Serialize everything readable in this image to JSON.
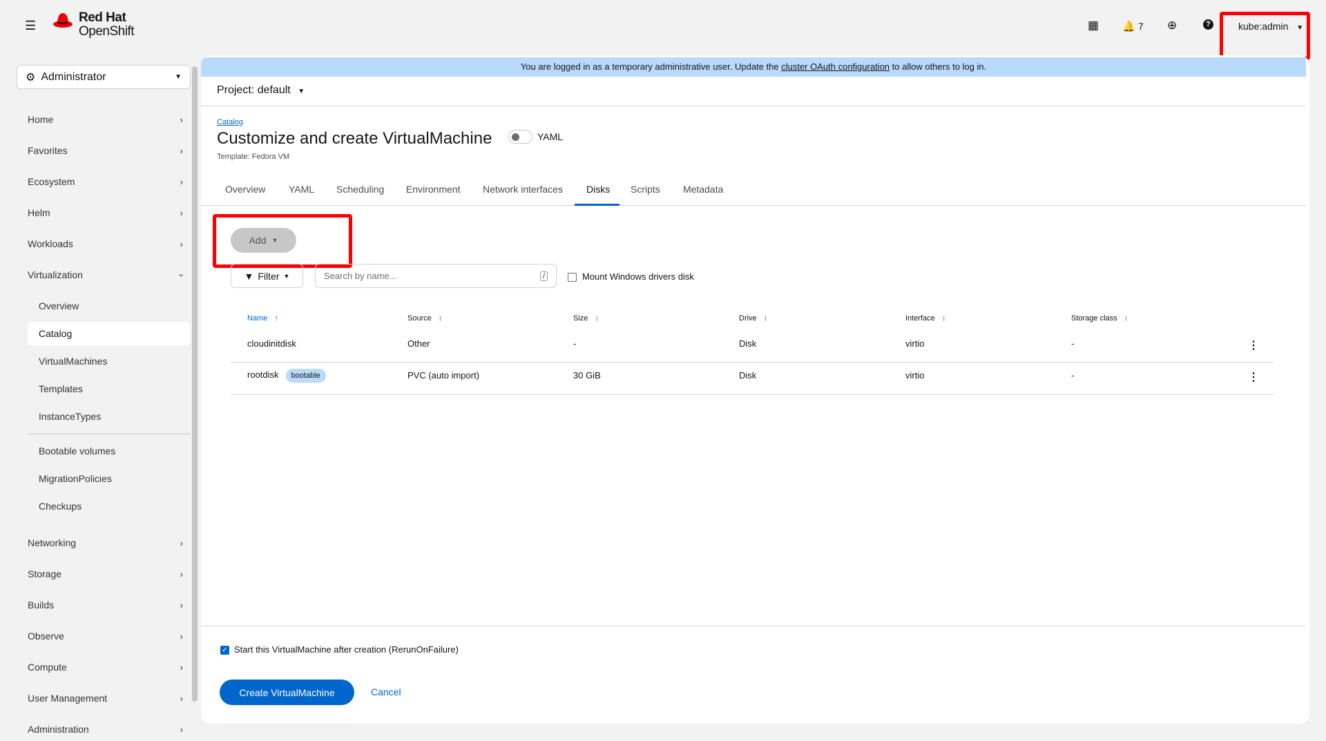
{
  "header": {
    "brand_line1": "Red Hat",
    "brand_line2": "OpenShift",
    "notifications_count": "7",
    "user": "kube:admin"
  },
  "sidebar": {
    "perspective": "Administrator",
    "items": [
      {
        "label": "Home"
      },
      {
        "label": "Favorites"
      },
      {
        "label": "Ecosystem"
      },
      {
        "label": "Helm"
      },
      {
        "label": "Workloads"
      },
      {
        "label": "Virtualization"
      }
    ],
    "virt_items": [
      {
        "label": "Overview"
      },
      {
        "label": "Catalog"
      },
      {
        "label": "VirtualMachines"
      },
      {
        "label": "Templates"
      },
      {
        "label": "InstanceTypes"
      },
      {
        "label": "Bootable volumes"
      },
      {
        "label": "MigrationPolicies"
      },
      {
        "label": "Checkups"
      }
    ],
    "items2": [
      {
        "label": "Networking"
      },
      {
        "label": "Storage"
      },
      {
        "label": "Builds"
      },
      {
        "label": "Observe"
      },
      {
        "label": "Compute"
      },
      {
        "label": "User Management"
      },
      {
        "label": "Administration"
      }
    ]
  },
  "banner": {
    "before": "You are logged in as a temporary administrative user. Update the ",
    "link": "cluster OAuth configuration",
    "after": " to allow others to log in."
  },
  "project": "Project: default",
  "breadcrumb": "Catalog",
  "title": "Customize and create VirtualMachine",
  "yaml_toggle": "YAML",
  "template": "Template: Fedora VM",
  "tabs": [
    {
      "label": "Overview"
    },
    {
      "label": "YAML"
    },
    {
      "label": "Scheduling"
    },
    {
      "label": "Environment"
    },
    {
      "label": "Network interfaces"
    },
    {
      "label": "Disks"
    },
    {
      "label": "Scripts"
    },
    {
      "label": "Metadata"
    }
  ],
  "disks": {
    "add": "Add",
    "filter": "Filter",
    "search_placeholder": "Search by name...",
    "search_hint": "/",
    "mount_windows": "Mount Windows drivers disk",
    "columns": [
      "Name",
      "Source",
      "Size",
      "Drive",
      "Interface",
      "Storage class"
    ],
    "rows": [
      {
        "name": "cloudinitdisk",
        "badge": "",
        "source": "Other",
        "size": "-",
        "drive": "Disk",
        "interface": "virtio",
        "storage_class": "-"
      },
      {
        "name": "rootdisk",
        "badge": "bootable",
        "source": "PVC (auto import)",
        "size": "30 GiB",
        "drive": "Disk",
        "interface": "virtio",
        "storage_class": "-"
      }
    ]
  },
  "footer": {
    "start_label": "Start this VirtualMachine after creation (RerunOnFailure)",
    "start_checked": true,
    "create": "Create VirtualMachine",
    "cancel": "Cancel"
  }
}
